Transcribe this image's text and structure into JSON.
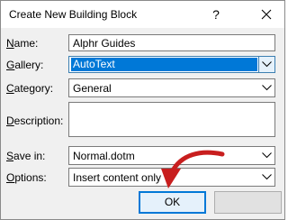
{
  "window": {
    "title": "Create New Building Block"
  },
  "titlebar": {
    "help_glyph": "?"
  },
  "fields": {
    "name": {
      "label_accel": "N",
      "label_rest": "ame:",
      "value": "Alphr Guides"
    },
    "gallery": {
      "label_accel": "G",
      "label_rest": "allery:",
      "value": "AutoText"
    },
    "category": {
      "label_accel": "C",
      "label_rest": "ategory:",
      "value": "General"
    },
    "description": {
      "label_accel": "D",
      "label_rest": "escription:",
      "value": ""
    },
    "save_in": {
      "label_accel": "S",
      "label_rest": "ave in:",
      "value": "Normal.dotm"
    },
    "options": {
      "label_accel": "O",
      "label_rest": "ptions:",
      "value": "Insert content only"
    }
  },
  "buttons": {
    "ok_label": "OK",
    "cancel_label": ""
  },
  "colors": {
    "selection": "#0078d7",
    "annotation_arrow": "#c81e1e",
    "focus_border": "#0078d7"
  }
}
